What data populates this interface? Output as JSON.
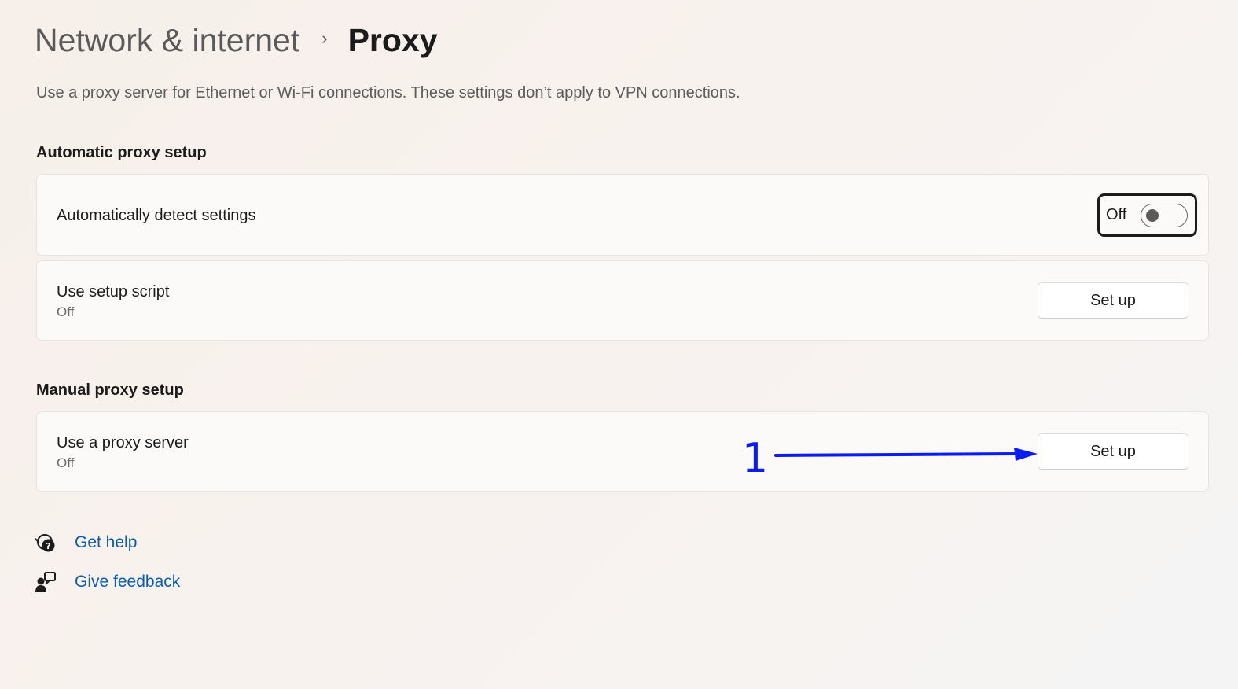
{
  "header": {
    "parent": "Network & internet",
    "separator": "›",
    "current": "Proxy"
  },
  "description": "Use a proxy server for Ethernet or Wi-Fi connections. These settings don’t apply to VPN connections.",
  "automatic": {
    "section_title": "Automatic proxy setup",
    "detect": {
      "label": "Automatically detect settings",
      "state": "Off",
      "toggle_on": false
    },
    "script": {
      "label": "Use setup script",
      "status": "Off",
      "button": "Set up"
    }
  },
  "manual": {
    "section_title": "Manual proxy setup",
    "proxy_server": {
      "label": "Use a proxy server",
      "status": "Off",
      "button": "Set up"
    }
  },
  "links": {
    "help": "Get help",
    "feedback": "Give feedback"
  },
  "annotation": {
    "number": "1",
    "color": "#0a1cf0"
  },
  "colors": {
    "link": "#0b5cad",
    "card_bg": "#fbfaf9"
  },
  "icons": {
    "help": "help-chat-icon",
    "feedback": "feedback-person-icon",
    "chevron": "chevron-right-icon"
  }
}
